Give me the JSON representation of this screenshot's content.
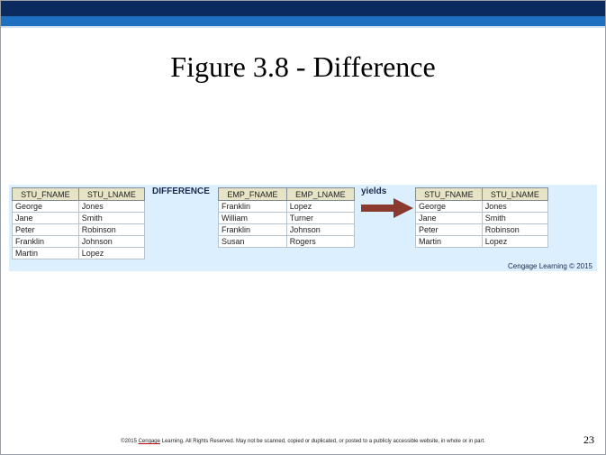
{
  "title": "Figure 3.8 - Difference",
  "operator_label": "DIFFERENCE",
  "yields_label": "yields",
  "table1": {
    "headers": [
      "STU_FNAME",
      "STU_LNAME"
    ],
    "rows": [
      [
        "George",
        "Jones"
      ],
      [
        "Jane",
        "Smith"
      ],
      [
        "Peter",
        "Robinson"
      ],
      [
        "Franklin",
        "Johnson"
      ],
      [
        "Martin",
        "Lopez"
      ]
    ]
  },
  "table2": {
    "headers": [
      "EMP_FNAME",
      "EMP_LNAME"
    ],
    "rows": [
      [
        "Franklin",
        "Lopez"
      ],
      [
        "William",
        "Turner"
      ],
      [
        "Franklin",
        "Johnson"
      ],
      [
        "Susan",
        "Rogers"
      ]
    ]
  },
  "table3": {
    "headers": [
      "STU_FNAME",
      "STU_LNAME"
    ],
    "rows": [
      [
        "George",
        "Jones"
      ],
      [
        "Jane",
        "Smith"
      ],
      [
        "Peter",
        "Robinson"
      ],
      [
        "Martin",
        "Lopez"
      ]
    ]
  },
  "credit": "Cengage Learning © 2015",
  "footer": {
    "prefix": "©2015 ",
    "brand": "Cengage",
    "rest": " Learning. All Rights Reserved. May not be scanned, copied or duplicated, or posted to a publicly accessible website, in whole or in part."
  },
  "page_number": "23",
  "colors": {
    "header_dark": "#0b2b5e",
    "header_blue": "#1f70c1",
    "panel": "#dcefff",
    "arrow": "#8b3a2f",
    "table_header": "#e7e3c6"
  }
}
